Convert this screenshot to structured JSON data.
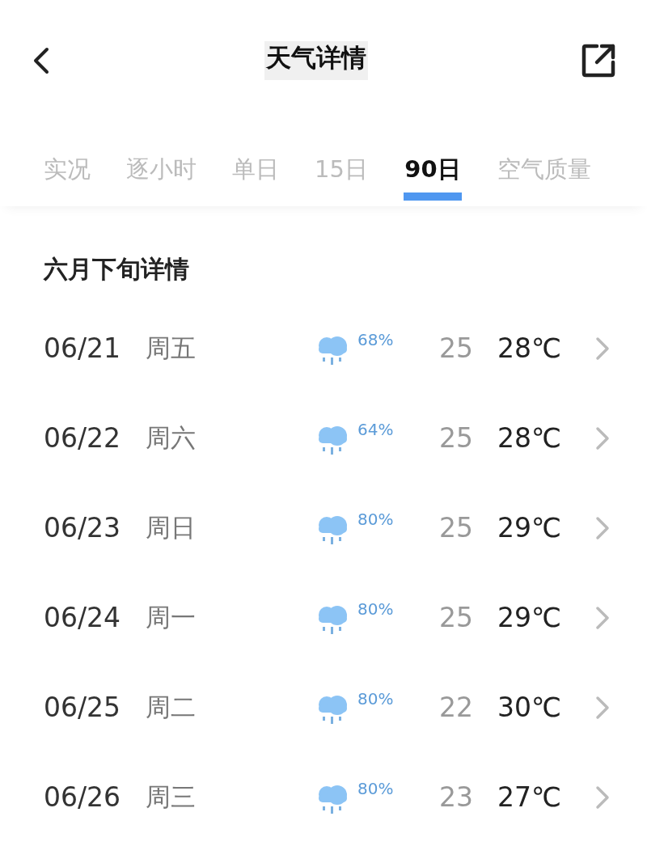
{
  "header": {
    "title": "天气详情"
  },
  "tabs": [
    {
      "label": "实况",
      "selected": false
    },
    {
      "label": "逐小时",
      "selected": false
    },
    {
      "label": "单日",
      "selected": false
    },
    {
      "label": "15日",
      "selected": false
    },
    {
      "label": "90日",
      "selected": true
    },
    {
      "label": "空气质量",
      "selected": false
    }
  ],
  "section": {
    "title": "六月下旬详情"
  },
  "days": [
    {
      "date": "06/21",
      "weekday": "周五",
      "rain_chance": "68%",
      "low": "25",
      "high": "28℃"
    },
    {
      "date": "06/22",
      "weekday": "周六",
      "rain_chance": "64%",
      "low": "25",
      "high": "28℃"
    },
    {
      "date": "06/23",
      "weekday": "周日",
      "rain_chance": "80%",
      "low": "25",
      "high": "29℃"
    },
    {
      "date": "06/24",
      "weekday": "周一",
      "rain_chance": "80%",
      "low": "25",
      "high": "29℃"
    },
    {
      "date": "06/25",
      "weekday": "周二",
      "rain_chance": "80%",
      "low": "22",
      "high": "30℃"
    },
    {
      "date": "06/26",
      "weekday": "周三",
      "rain_chance": "80%",
      "low": "23",
      "high": "27℃"
    }
  ]
}
